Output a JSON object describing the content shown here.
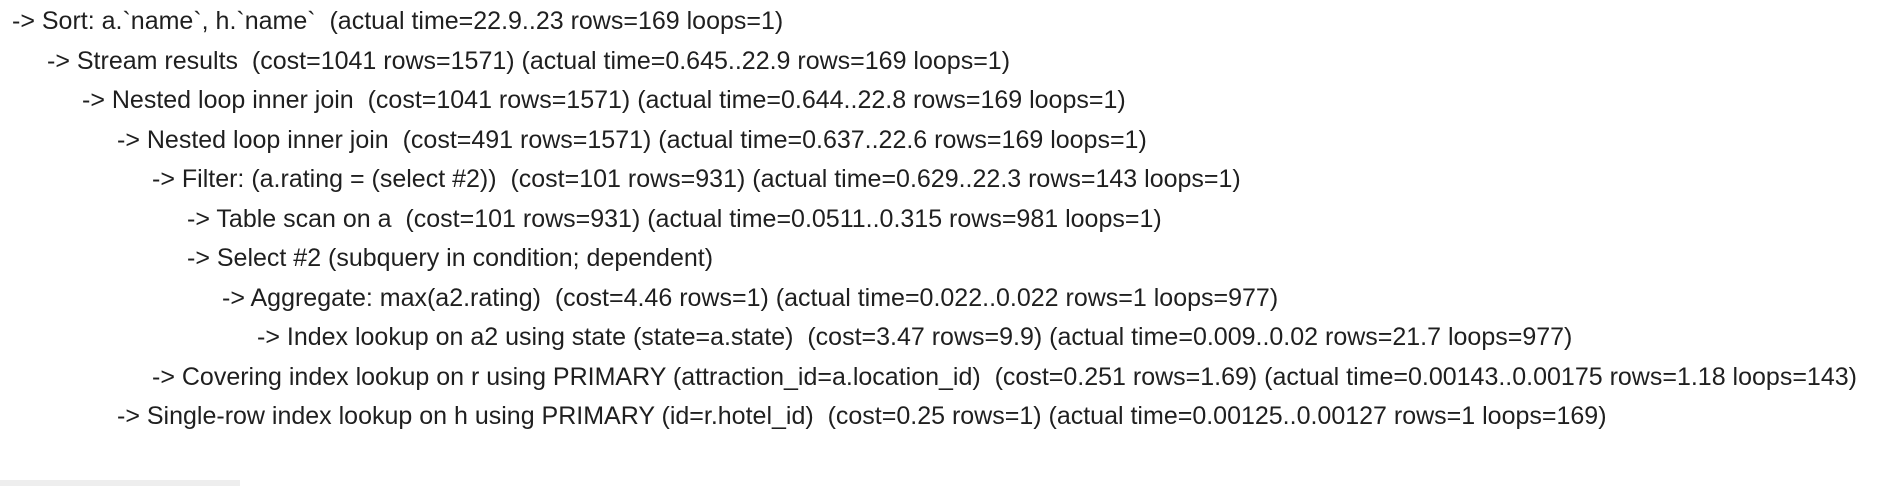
{
  "plan": {
    "lines": [
      {
        "indent": 0,
        "text": "-> Sort: a.`name`, h.`name`  (actual time=22.9..23 rows=169 loops=1)"
      },
      {
        "indent": 1,
        "text": "-> Stream results  (cost=1041 rows=1571) (actual time=0.645..22.9 rows=169 loops=1)"
      },
      {
        "indent": 2,
        "text": "-> Nested loop inner join  (cost=1041 rows=1571) (actual time=0.644..22.8 rows=169 loops=1)"
      },
      {
        "indent": 3,
        "text": "-> Nested loop inner join  (cost=491 rows=1571) (actual time=0.637..22.6 rows=169 loops=1)"
      },
      {
        "indent": 4,
        "text": "-> Filter: (a.rating = (select #2))  (cost=101 rows=931) (actual time=0.629..22.3 rows=143 loops=1)"
      },
      {
        "indent": 5,
        "text": "-> Table scan on a  (cost=101 rows=931) (actual time=0.0511..0.315 rows=981 loops=1)"
      },
      {
        "indent": 5,
        "text": "-> Select #2 (subquery in condition; dependent)"
      },
      {
        "indent": 6,
        "text": "-> Aggregate: max(a2.rating)  (cost=4.46 rows=1) (actual time=0.022..0.022 rows=1 loops=977)"
      },
      {
        "indent": 7,
        "text": "-> Index lookup on a2 using state (state=a.state)  (cost=3.47 rows=9.9) (actual time=0.009..0.02 rows=21.7 loops=977)"
      },
      {
        "indent": 4,
        "text": "-> Covering index lookup on r using PRIMARY (attraction_id=a.location_id)  (cost=0.251 rows=1.69) (actual time=0.00143..0.00175 rows=1.18 loops=143)"
      },
      {
        "indent": 3,
        "text": "-> Single-row index lookup on h using PRIMARY (id=r.hotel_id)  (cost=0.25 rows=1) (actual time=0.00125..0.00127 rows=1 loops=169)"
      }
    ]
  }
}
